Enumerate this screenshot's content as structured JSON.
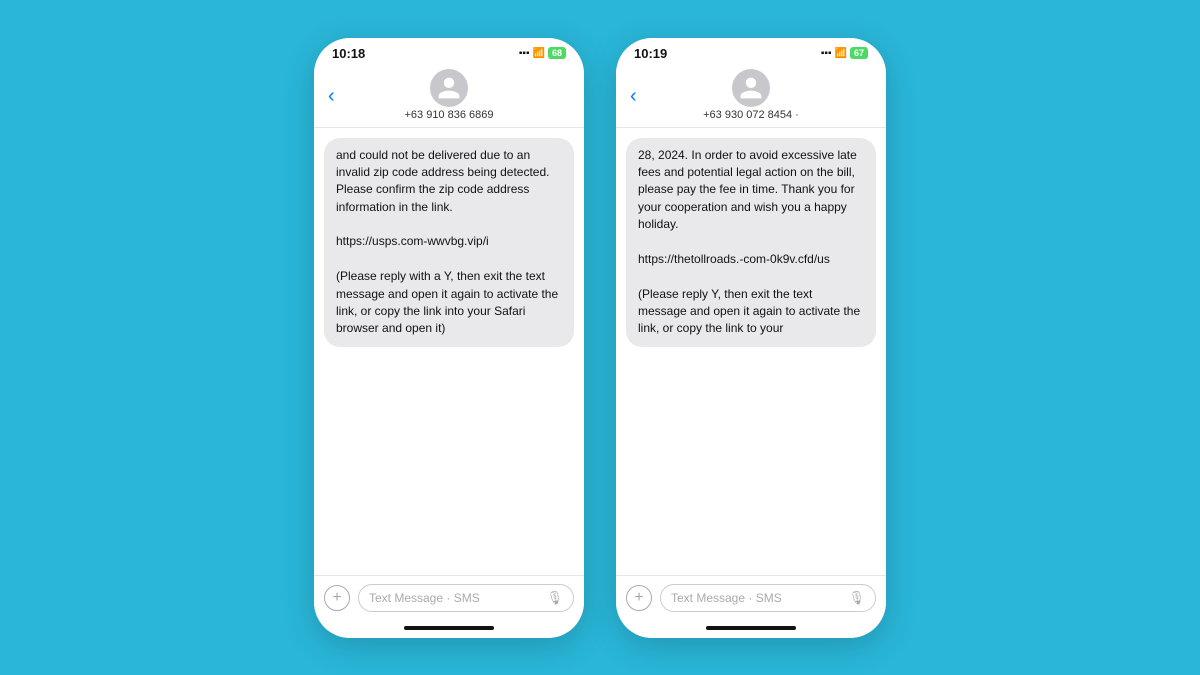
{
  "phone1": {
    "status_time": "10:18",
    "signal": "▪▪▪",
    "wifi": "WiFi",
    "battery": "68",
    "phone_number": "+63 910 836 6869",
    "message": "and could not be delivered due to an invalid zip code address being detected. Please confirm the zip code address information in the link.\n\nhttps://usps.com-wwvbg.vip/i\n\n(Please reply with a Y, then exit the text message and open it again to activate the link, or copy the link into your Safari browser and open it)",
    "input_placeholder": "Text Message · SMS",
    "back_label": "‹",
    "plus_label": "+",
    "mic_label": "🎤"
  },
  "phone2": {
    "status_time": "10:19",
    "signal": "▪▪▪",
    "wifi": "WiFi",
    "battery": "67",
    "phone_number": "+63 930 072 8454 ·",
    "message": "28, 2024. In order to avoid excessive late fees and potential legal action on the bill, please pay the fee in time. Thank you for your cooperation and wish you a happy holiday.\n\nhttps://thetollroads.-com-0k9v.cfd/us\n\n(Please reply Y, then exit the text message and open it again to activate the link, or copy the link to your",
    "input_placeholder": "Text Message · SMS",
    "back_label": "‹",
    "plus_label": "+",
    "mic_label": "🎤"
  }
}
